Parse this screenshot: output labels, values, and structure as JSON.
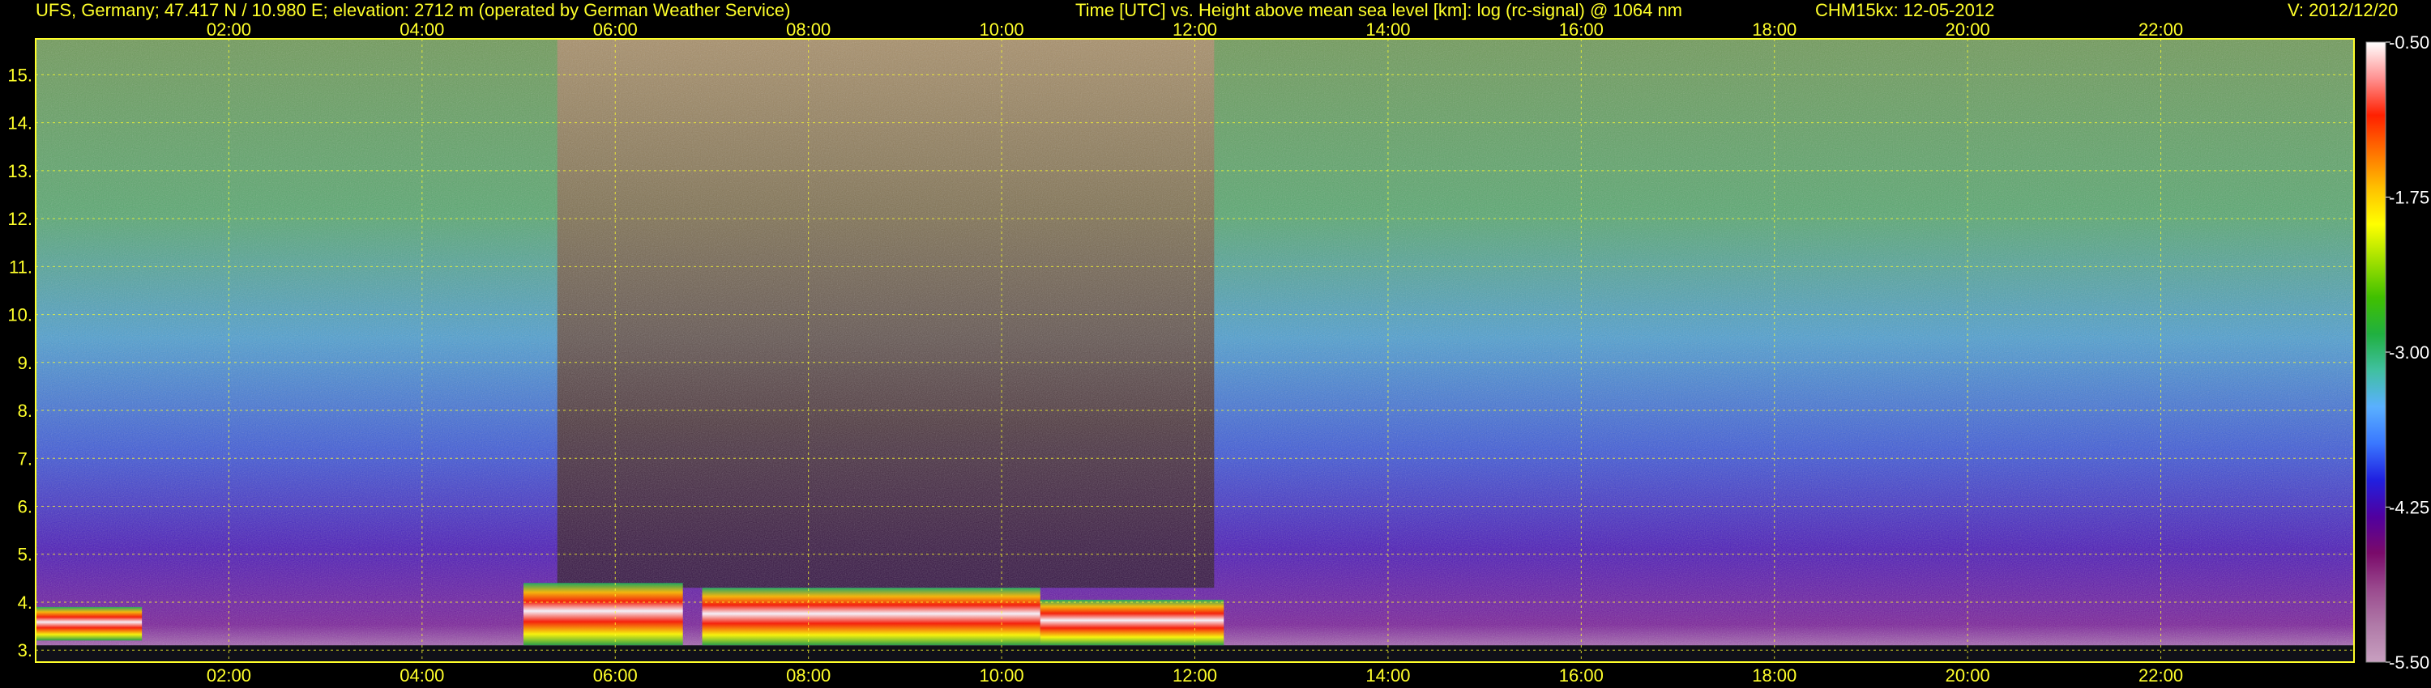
{
  "header": {
    "station": "UFS, Germany; 47.417 N / 10.980 E; elevation: 2712 m  (operated by German Weather Service)",
    "description": "Time [UTC] vs. Height above mean sea level [km]: log (rc-signal) @ 1064 nm",
    "instrument_date": "CHM15kx: 12-05-2012",
    "version": "V: 2012/12/20"
  },
  "chart_data": {
    "type": "heatmap",
    "x_ticks": [
      "02:00",
      "04:00",
      "06:00",
      "08:00",
      "10:00",
      "12:00",
      "14:00",
      "16:00",
      "18:00",
      "20:00",
      "22:00"
    ],
    "x_tick_hours": [
      2,
      4,
      6,
      8,
      10,
      12,
      14,
      16,
      18,
      20,
      22
    ],
    "xlim_hours": [
      0,
      24
    ],
    "y_ticks": [
      "3.",
      "4.",
      "5.",
      "6.",
      "7.",
      "8.",
      "9.",
      "10.",
      "11.",
      "12.",
      "13.",
      "14.",
      "15."
    ],
    "y_tick_values": [
      3,
      4,
      5,
      6,
      7,
      8,
      9,
      10,
      11,
      12,
      13,
      14,
      15
    ],
    "ylim_km": [
      2.75,
      15.75
    ],
    "grid": true,
    "colorbar": {
      "ticks": [
        "-0.50",
        "-1.75",
        "-3.00",
        "-4.25",
        "-5.50"
      ],
      "tick_values": [
        -0.5,
        -1.75,
        -3.0,
        -4.25,
        -5.5
      ],
      "range": [
        -5.5,
        -0.5
      ],
      "colors": [
        "#c8a0c0",
        "#b07aa8",
        "#9a4a8e",
        "#7a0a6a",
        "#5000a0",
        "#2020e0",
        "#3a78ff",
        "#5ab0ff",
        "#40c0a0",
        "#20b040",
        "#40c000",
        "#a0e000",
        "#ffff00",
        "#ffc000",
        "#ff7000",
        "#ff2000",
        "#ff9090",
        "#ffffff"
      ]
    },
    "cloud_layers": [
      {
        "start_hour": 5.05,
        "end_hour": 6.7,
        "base_km": 3.1,
        "top_km": 4.4
      },
      {
        "start_hour": 6.9,
        "end_hour": 10.4,
        "base_km": 3.1,
        "top_km": 4.3
      },
      {
        "start_hour": 10.4,
        "end_hour": 12.3,
        "base_km": 3.1,
        "top_km": 4.05
      },
      {
        "start_hour": 0.0,
        "end_hour": 1.1,
        "base_km": 3.2,
        "top_km": 3.9
      }
    ]
  }
}
